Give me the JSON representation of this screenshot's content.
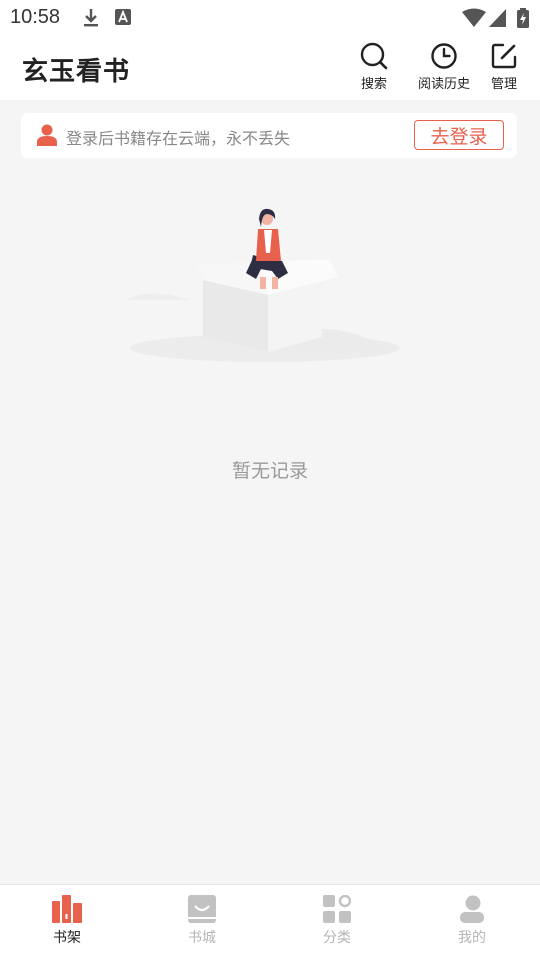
{
  "status_bar": {
    "time": "10:58",
    "icons": [
      "download-icon",
      "font-app-icon",
      "wifi-icon",
      "signal-icon",
      "battery-charging-icon"
    ]
  },
  "header": {
    "title": "玄玉看书",
    "buttons": [
      {
        "label": "搜索",
        "icon": "search-icon"
      },
      {
        "label": "阅读历史",
        "icon": "clock-icon"
      },
      {
        "label": "管理",
        "icon": "edit-icon"
      }
    ]
  },
  "login_banner": {
    "text": "登录后书籍存在云端，永不丢失",
    "button_label": "去登录",
    "icon": "user-icon"
  },
  "empty_state": {
    "text": "暂无记录",
    "illustration": "person-sitting-on-box-illustration"
  },
  "bottom_nav": {
    "items": [
      {
        "label": "书架",
        "icon": "bookshelf-icon",
        "active": true
      },
      {
        "label": "书城",
        "icon": "bookstore-icon",
        "active": false
      },
      {
        "label": "分类",
        "icon": "category-icon",
        "active": false
      },
      {
        "label": "我的",
        "icon": "profile-icon",
        "active": false
      }
    ]
  },
  "colors": {
    "accent": "#e8614d",
    "inactive": "#b5b5b5",
    "background": "#f5f5f5"
  }
}
